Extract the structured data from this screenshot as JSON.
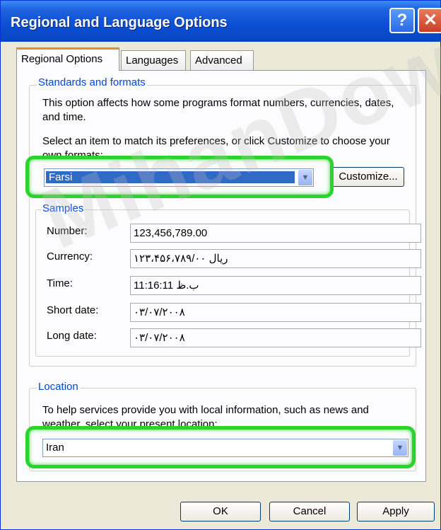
{
  "window": {
    "title": "Regional and Language Options"
  },
  "title_buttons": {
    "help": "?",
    "close": "✕"
  },
  "tabs": [
    {
      "label": "Regional Options",
      "active": true
    },
    {
      "label": "Languages",
      "active": false
    },
    {
      "label": "Advanced",
      "active": false
    }
  ],
  "standards": {
    "legend": "Standards and formats",
    "desc": "This option affects how some programs format numbers, currencies, dates, and time.",
    "instruction": "Select an item to match its preferences, or click Customize to choose your own formats:",
    "format_value": "Farsi",
    "customize_label": "Customize..."
  },
  "samples": {
    "legend": "Samples",
    "rows": [
      {
        "label": "Number:",
        "value": "123,456,789.00"
      },
      {
        "label": "Currency:",
        "value": "۱۲۳،۴۵۶،۷۸۹/۰۰ ریال"
      },
      {
        "label": "Time:",
        "value": "11:16:11 ب.ظ"
      },
      {
        "label": "Short date:",
        "value": "۰۳/۰۷/۲۰۰۸"
      },
      {
        "label": "Long date:",
        "value": "۰۳/۰۷/۲۰۰۸"
      }
    ]
  },
  "location": {
    "legend": "Location",
    "desc": "To help services provide you with local information, such as news and weather, select your present location:",
    "value": "Iran"
  },
  "footer": {
    "ok": "OK",
    "cancel": "Cancel",
    "apply": "Apply"
  },
  "watermark": "MihanDow"
}
